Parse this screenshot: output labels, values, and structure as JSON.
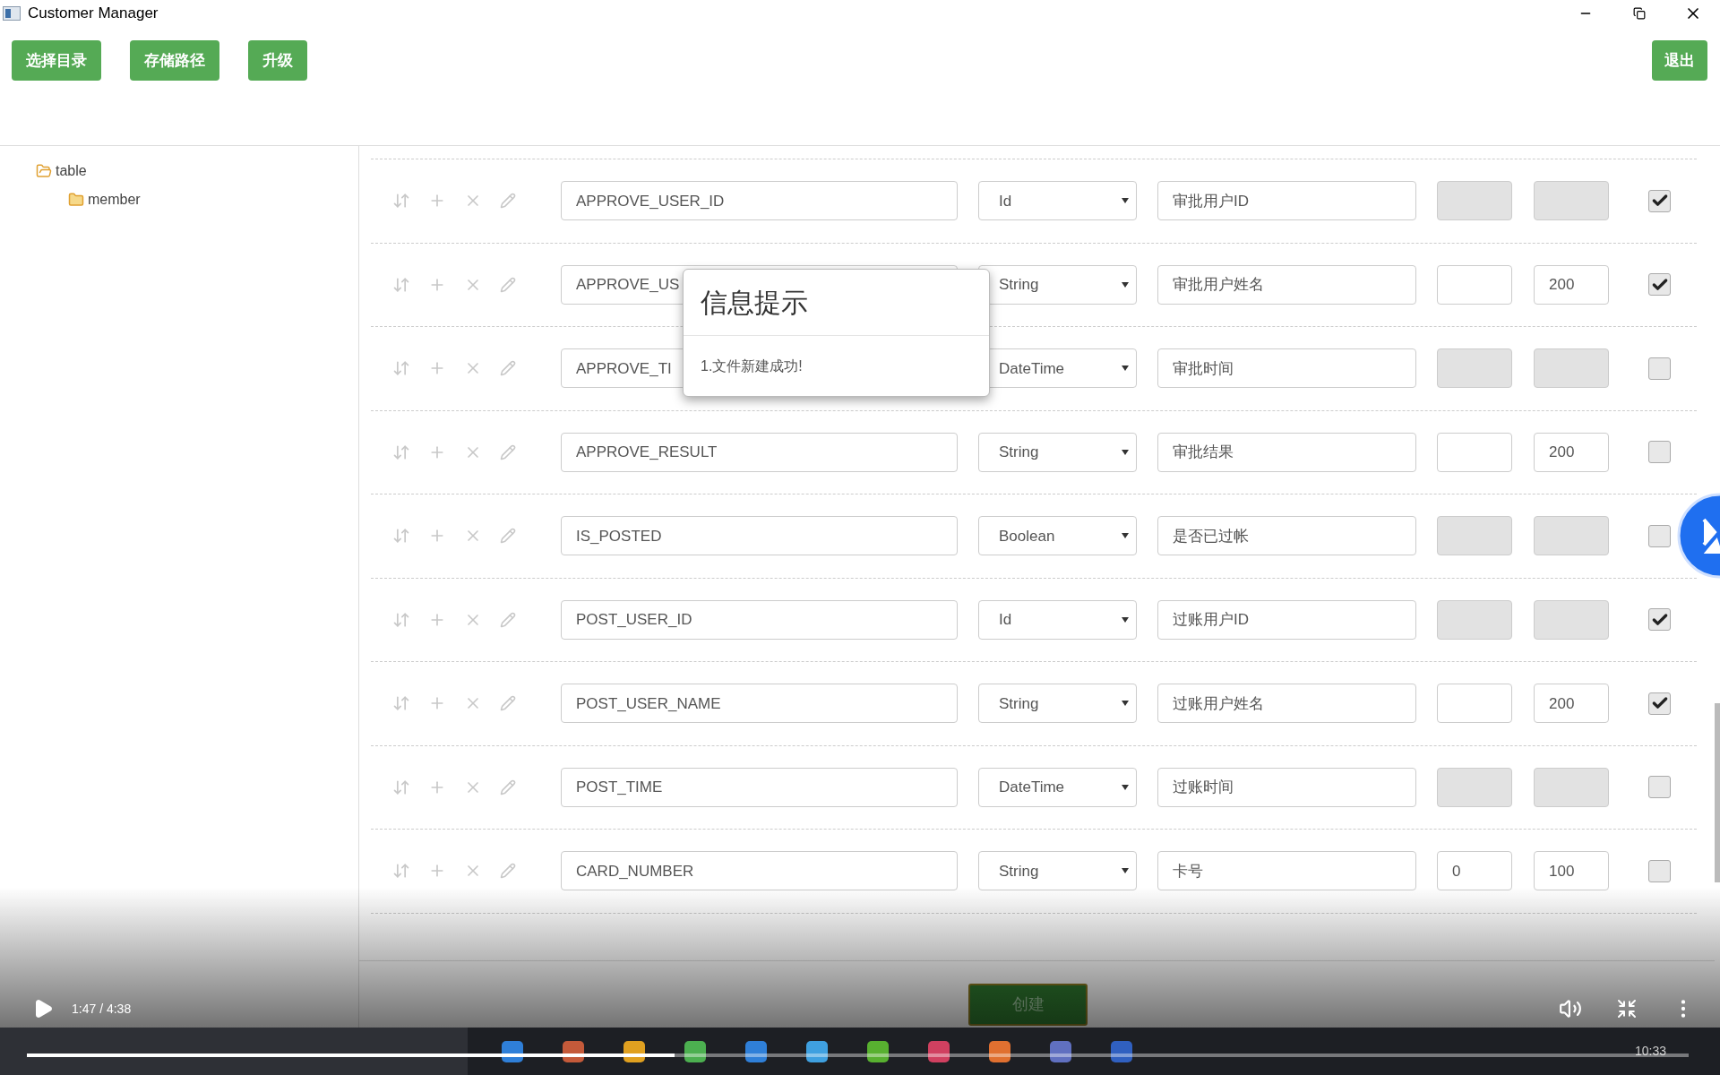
{
  "window": {
    "title": "Customer Manager"
  },
  "toolbar": {
    "buttons": [
      "选择目录",
      "存储路径",
      "升级"
    ],
    "exit_button": "退出"
  },
  "tree": [
    {
      "label": "table",
      "expanded": true,
      "children": [
        {
          "label": "member",
          "expanded": false
        }
      ]
    }
  ],
  "rows": [
    {
      "name": "APPROVE_USER_ID",
      "type": "Id",
      "description": "审批用户ID",
      "range_disabled": true,
      "checked": true
    },
    {
      "name": "APPROVE_US",
      "type": "String",
      "description": "审批用户姓名",
      "range_disabled": false,
      "max": "200",
      "checked": true
    },
    {
      "name": "APPROVE_TI",
      "type": "DateTime",
      "description": "审批时间",
      "range_disabled": true,
      "checked": false
    },
    {
      "name": "APPROVE_RESULT",
      "type": "String",
      "description": "审批结果",
      "range_disabled": false,
      "max": "200",
      "checked": false
    },
    {
      "name": "IS_POSTED",
      "type": "Boolean",
      "description": "是否已过帐",
      "range_disabled": true,
      "checked": false
    },
    {
      "name": "POST_USER_ID",
      "type": "Id",
      "description": "过账用户ID",
      "range_disabled": true,
      "checked": true
    },
    {
      "name": "POST_USER_NAME",
      "type": "String",
      "description": "过账用户姓名",
      "range_disabled": false,
      "max": "200",
      "checked": true
    },
    {
      "name": "POST_TIME",
      "type": "DateTime",
      "description": "过账时间",
      "range_disabled": true,
      "checked": false
    },
    {
      "name": "CARD_NUMBER",
      "type": "String",
      "description": "卡号",
      "range_disabled": false,
      "min": "0",
      "max": "100",
      "checked": false
    }
  ],
  "dialog": {
    "title": "信息提示",
    "message": "1.文件新建成功!"
  },
  "create_button": "创建",
  "video_player": {
    "time": "1:47 / 4:38",
    "level": 0.39
  },
  "taskbar": {
    "clock": "10:33"
  }
}
